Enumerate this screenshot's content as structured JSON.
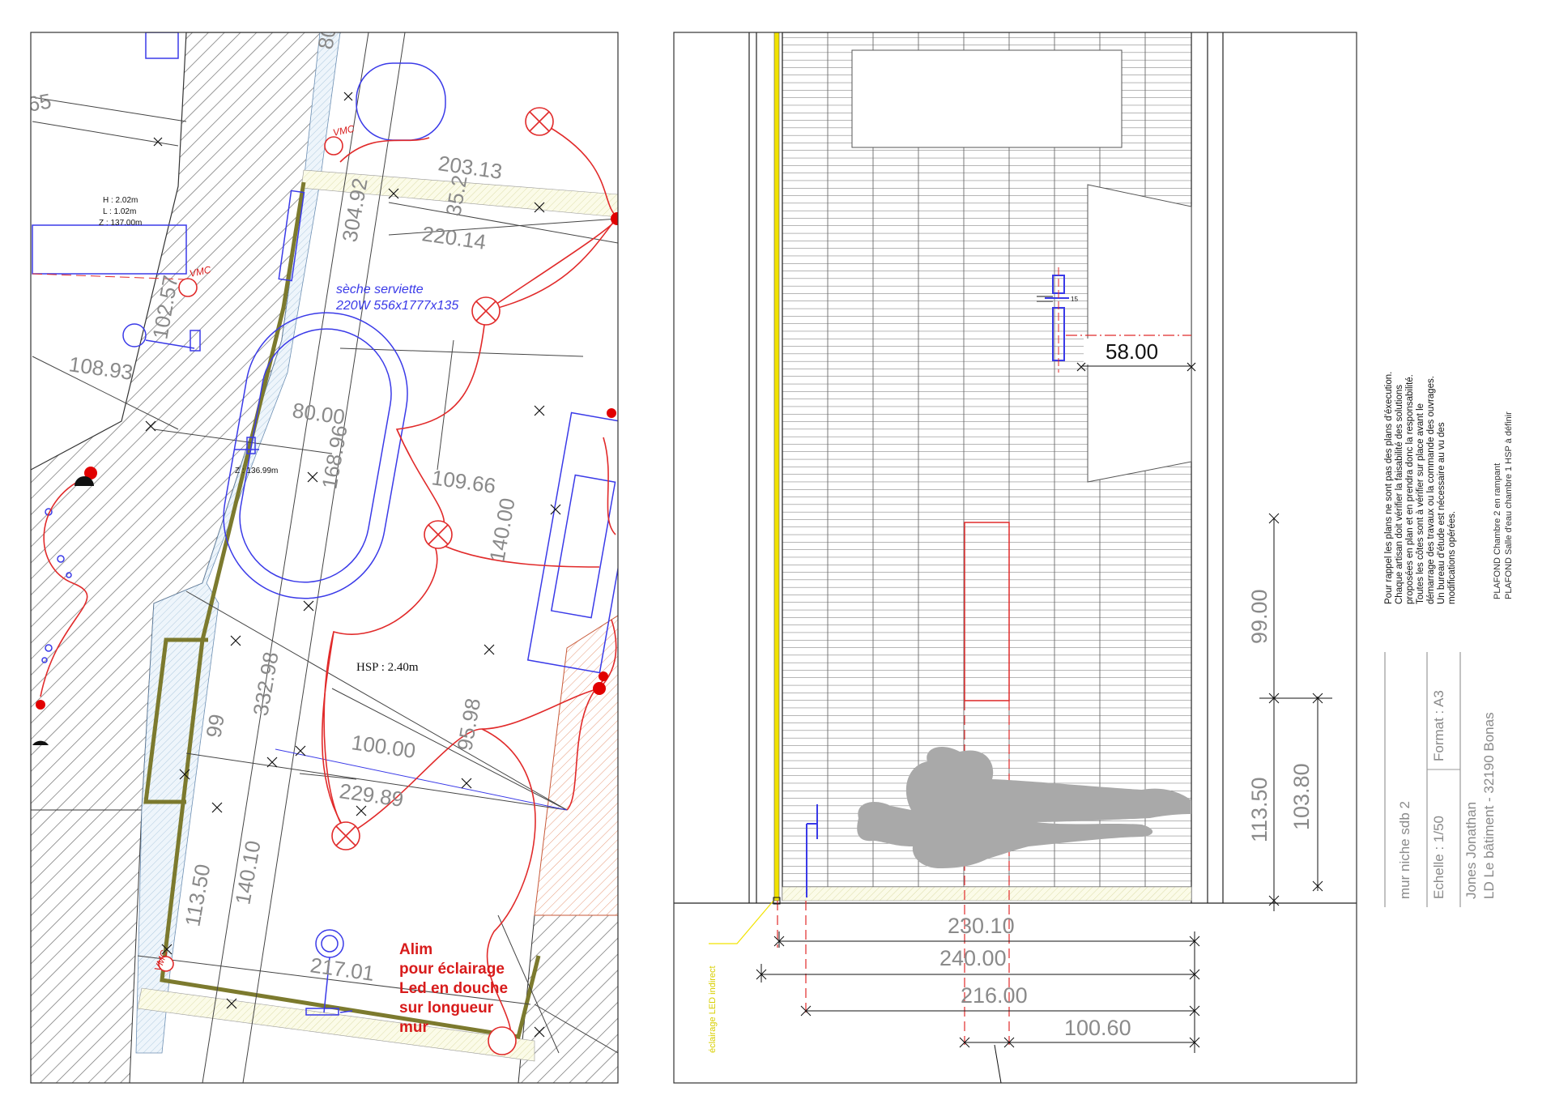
{
  "colors": {
    "red_electrical": "#e12a2a",
    "blue_fixtures": "#3a3ae8",
    "wall_hatch": "#7f7f7f",
    "led_line": "#f2e300",
    "olive_wall": "#7c7a2e",
    "dimension_gray": "#8a8a8a",
    "person_silhouette": "#a9a9a9"
  },
  "icons": [
    "ceiling-light-icon",
    "vmc-vent-icon",
    "shower-head-icon",
    "person-silhouette-icon"
  ],
  "plan": {
    "height_note": {
      "h": "H : 2.02m",
      "l": "L : 1.02m",
      "z": "Z : 137.00m"
    },
    "z_tub": "Z : 136.99m",
    "hsp": "HSP : 2.40m",
    "vmc_labels": [
      "VMC",
      "VMC",
      "VMC"
    ],
    "towel_dryer": {
      "line1": "sèche serviette",
      "line2": "220W 556x1777x135"
    },
    "led_note": [
      "Alim",
      "pour éclairage",
      "Led en douche",
      "sur longueur",
      "mur"
    ],
    "dimensions": {
      "d65": "65",
      "d80top": "80",
      "d203_13": "203.13",
      "d35_2": "35.2",
      "d304_92": "304.92",
      "d220_14": "220.14",
      "d102_57": "102.57",
      "d108_93": "108.93",
      "d80_00": "80.00",
      "d168_96": "168.96",
      "d109_66": "109.66",
      "d140_00": "140.00",
      "d332_98": "332.98",
      "d99": "99",
      "d95_98": "95.98",
      "d100_00": "100.00",
      "d229_89": "229.89",
      "d140_10": "140.10",
      "d113_50": "113.50",
      "d217_01": "217.01"
    }
  },
  "elevation": {
    "dim_58": "58.00",
    "dim_15": "15",
    "dim_230_10": "230.10",
    "dim_240_00": "240.00",
    "dim_216_00": "216.00",
    "dim_100_60": "100.60",
    "dim_99_00": "99.00",
    "dim_113_50": "113.50",
    "dim_103_80": "103.80",
    "led_label": "éclairage LED indirect"
  },
  "notes": {
    "lines": [
      "Pour rappel les plans ne sont pas des plans d'éxecution.",
      "Chaque artisan doit vérifier la faisabilité des solutions",
      "proposées en plan et en prendra donc la responsabilité.",
      "Toutes les côtes sont à vérifier sur place avant le",
      "démarrage des travaux ou la commande des ouvrages.",
      "Un bureau d'étude est nécessaire au vu des",
      "modifications opérées."
    ],
    "ceiling": [
      "PLAFOND Chambre 2 en rampant",
      "PLAFOND Salle d'eau chambre 1 HSP à définir"
    ]
  },
  "title_block": {
    "title": "mur niche sdb 2",
    "scale": "Echelle : 1/50",
    "format": "Format : A3",
    "client": "Jones Jonathan",
    "address": "LD Le bâtiment - 32190 Bonas"
  }
}
